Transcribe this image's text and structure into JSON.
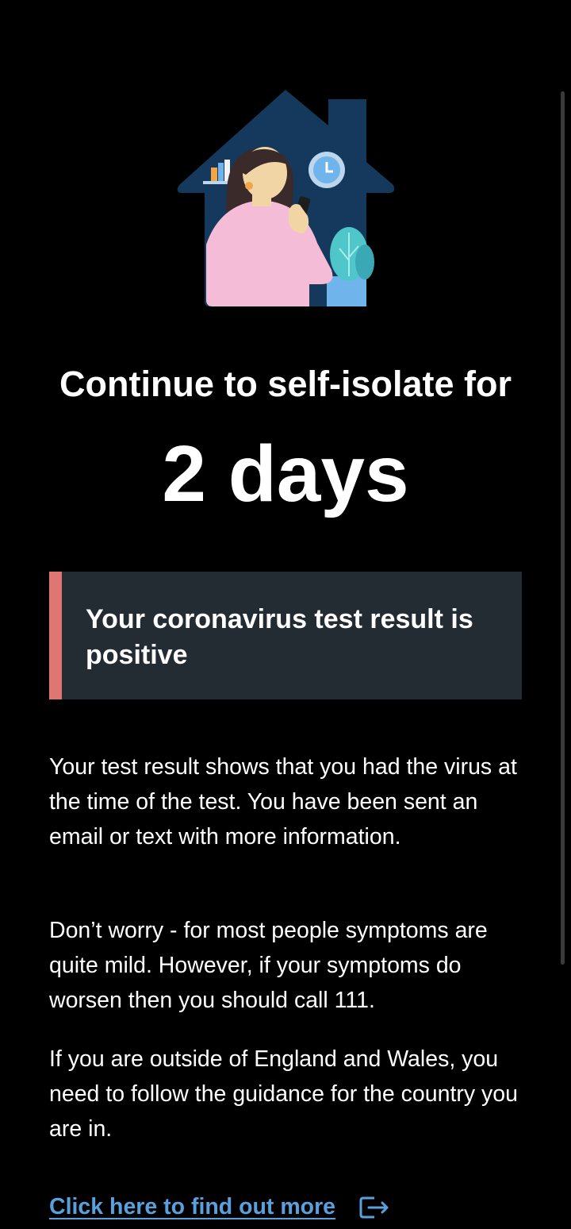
{
  "illustration": {
    "icon_name": "self-isolating-person-at-home-illustration"
  },
  "isolation": {
    "heading": "Continue to self-isolate for",
    "days_label": "2 days"
  },
  "result": {
    "message": "Your coronavirus test result is positive",
    "accent_color": "#e07672"
  },
  "info": {
    "paragraph_1": "Your test result shows that you had the virus at the time of the test. You have been sent an email or text with more information.",
    "paragraph_2": "Don’t worry - for most people symptoms are quite mild. However, if your symptoms do worsen then you should call 111.",
    "paragraph_3": "If you are outside of England and Wales, you need to follow the guidance for the country you are in."
  },
  "link": {
    "label": "Click here to find out more",
    "icon_name": "external-link-icon",
    "color": "#5aa0dc"
  }
}
